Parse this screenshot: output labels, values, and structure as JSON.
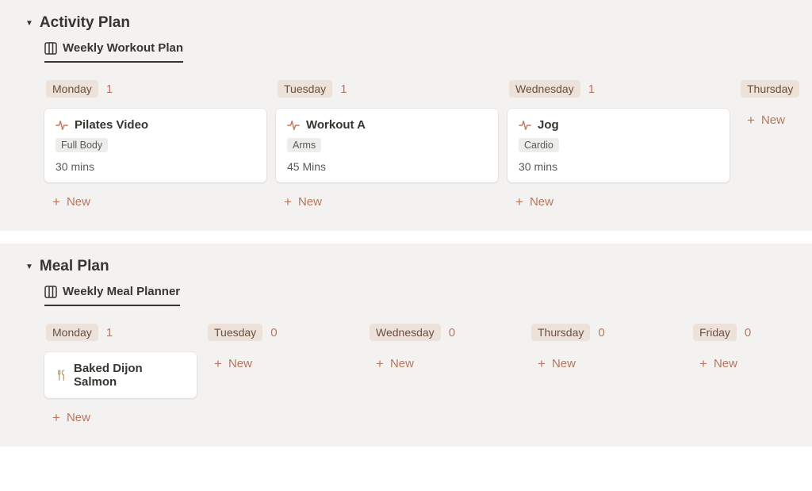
{
  "common": {
    "new_label": "New"
  },
  "activity": {
    "title": "Activity Plan",
    "view_label": "Weekly Workout Plan",
    "columns": [
      {
        "day": "Monday",
        "count": "1",
        "cards": [
          {
            "title": "Pilates Video",
            "tag": "Full Body",
            "duration": "30 mins"
          }
        ]
      },
      {
        "day": "Tuesday",
        "count": "1",
        "cards": [
          {
            "title": "Workout A",
            "tag": "Arms",
            "duration": "45 Mins"
          }
        ]
      },
      {
        "day": "Wednesday",
        "count": "1",
        "cards": [
          {
            "title": "Jog",
            "tag": "Cardio",
            "duration": "30 mins"
          }
        ]
      },
      {
        "day": "Thursday",
        "count": "",
        "cards": []
      }
    ]
  },
  "meal": {
    "title": "Meal Plan",
    "view_label": "Weekly Meal Planner",
    "columns": [
      {
        "day": "Monday",
        "count": "1",
        "cards": [
          {
            "title": "Baked Dijon Salmon"
          }
        ]
      },
      {
        "day": "Tuesday",
        "count": "0",
        "cards": []
      },
      {
        "day": "Wednesday",
        "count": "0",
        "cards": []
      },
      {
        "day": "Thursday",
        "count": "0",
        "cards": []
      },
      {
        "day": "Friday",
        "count": "0",
        "cards": []
      }
    ]
  }
}
